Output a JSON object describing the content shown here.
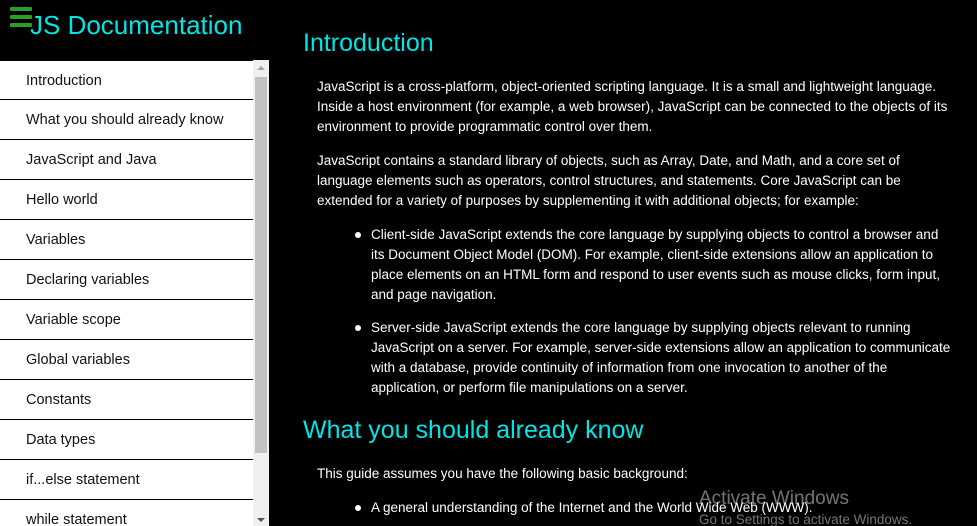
{
  "sidebar": {
    "title": "JS Documentation",
    "menu_icon": "hamburger-menu-icon",
    "items": [
      {
        "label": "Introduction"
      },
      {
        "label": "What you should already know"
      },
      {
        "label": "JavaScript and Java"
      },
      {
        "label": "Hello world"
      },
      {
        "label": "Variables"
      },
      {
        "label": "Declaring variables"
      },
      {
        "label": "Variable scope"
      },
      {
        "label": "Global variables"
      },
      {
        "label": "Constants"
      },
      {
        "label": "Data types"
      },
      {
        "label": "if...else statement"
      },
      {
        "label": "while statement"
      }
    ]
  },
  "main": {
    "sections": [
      {
        "heading": "Introduction",
        "paragraphs": [
          "JavaScript is a cross-platform, object-oriented scripting language. It is a small and lightweight language. Inside a host environment (for example, a web browser), JavaScript can be connected to the objects of its environment to provide programmatic control over them.",
          "JavaScript contains a standard library of objects, such as Array, Date, and Math, and a core set of language elements such as operators, control structures, and statements. Core JavaScript can be extended for a variety of purposes by supplementing it with additional objects; for example:"
        ],
        "bullets": [
          "Client-side JavaScript extends the core language by supplying objects to control a browser and its Document Object Model (DOM). For example, client-side extensions allow an application to place elements on an HTML form and respond to user events such as mouse clicks, form input, and page navigation.",
          "Server-side JavaScript extends the core language by supplying objects relevant to running JavaScript on a server. For example, server-side extensions allow an application to communicate with a database, provide continuity of information from one invocation to another of the application, or perform file manipulations on a server."
        ]
      },
      {
        "heading": "What you should already know",
        "paragraphs": [
          "This guide assumes you have the following basic background:"
        ],
        "bullets": [
          "A general understanding of the Internet and the World Wide Web (WWW)."
        ]
      }
    ]
  },
  "watermark": {
    "title": "Activate Windows",
    "subtitle": "Go to Settings to activate Windows."
  },
  "colors": {
    "background": "#000000",
    "heading": "#00e5e5",
    "text": "#ffffff",
    "nav_background": "#ffffff",
    "menu_icon": "#2a9d2a"
  }
}
